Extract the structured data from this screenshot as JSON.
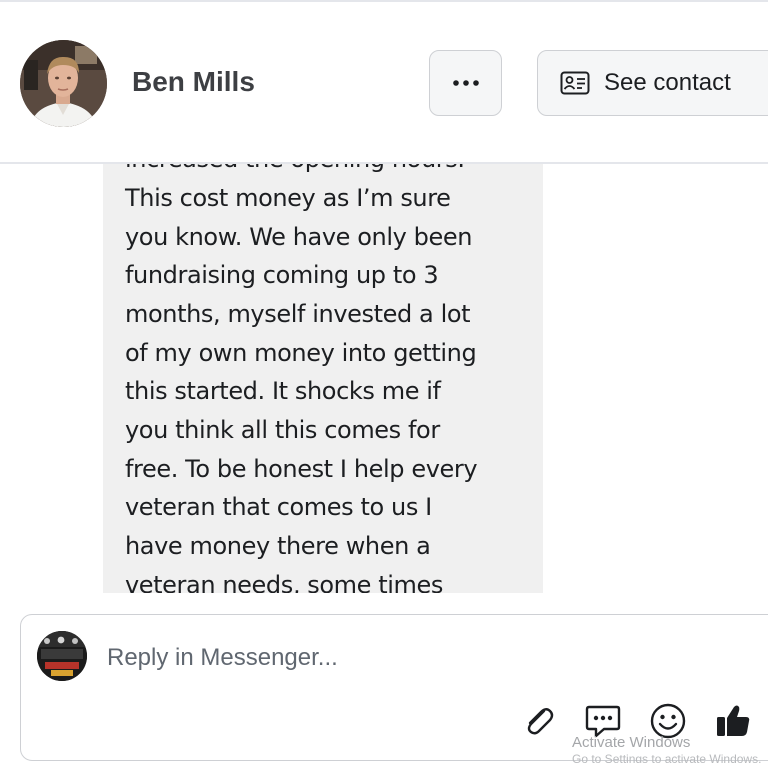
{
  "header": {
    "contact_name": "Ben Mills",
    "more_button_icon": "more-dots-icon",
    "see_contact_label": "See contact",
    "see_contact_icon": "contact-card-icon"
  },
  "message": {
    "lines": [
      "increased the opening hours.",
      "This cost money as I’m sure",
      "you know. We have only been",
      "fundraising coming up to 3",
      "months, myself invested a lot",
      "of my own money into getting",
      "this started. It shocks me if",
      "you think all this comes for",
      "free. To be honest I help every",
      "veteran that comes to us I",
      "have money there when a",
      "veteran needs, some times"
    ]
  },
  "reply": {
    "placeholder": "Reply in Messenger...",
    "icons": [
      "paperclip-icon",
      "chat-bubble-icon",
      "emoji-icon",
      "thumbs-up-icon"
    ]
  },
  "watermark": {
    "title": "Activate Windows",
    "subtitle": "Go to Settings to activate Windows."
  },
  "colors": {
    "bubble_bg": "#f0f0f0",
    "border": "#ced0d4",
    "text": "#1c1e21",
    "muted": "#606770"
  }
}
